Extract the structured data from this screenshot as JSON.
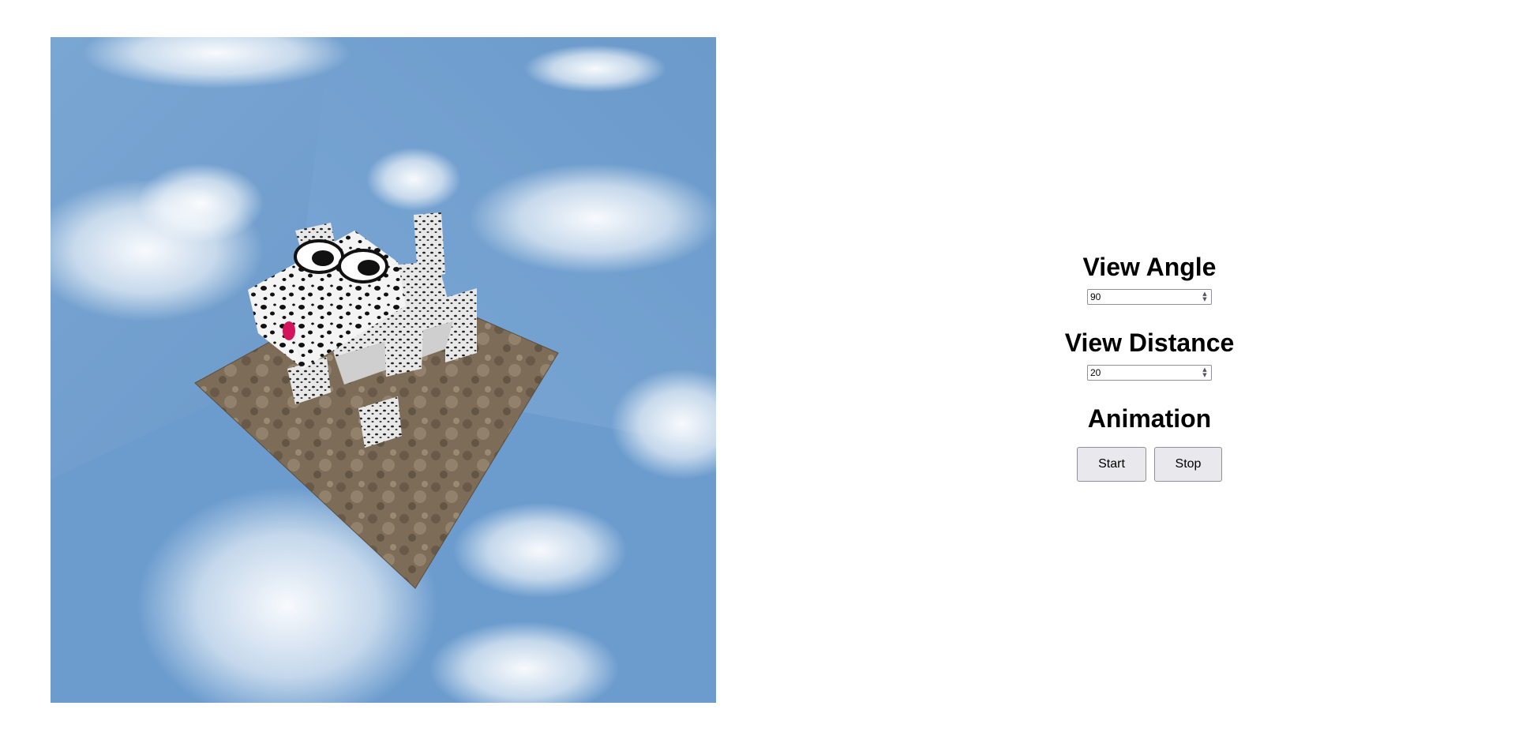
{
  "scene": {
    "description_icon": "webgl-canvas",
    "sky_color": "#6f9fcd",
    "ground_color": "#7a6a55",
    "dog_color": "#f2f2f2",
    "spot_color": "#111111",
    "tongue_color": "#d4145a"
  },
  "controls": {
    "view_angle": {
      "heading": "View Angle",
      "value": "90"
    },
    "view_distance": {
      "heading": "View Distance",
      "value": "20"
    },
    "animation": {
      "heading": "Animation",
      "start_label": "Start",
      "stop_label": "Stop"
    }
  }
}
